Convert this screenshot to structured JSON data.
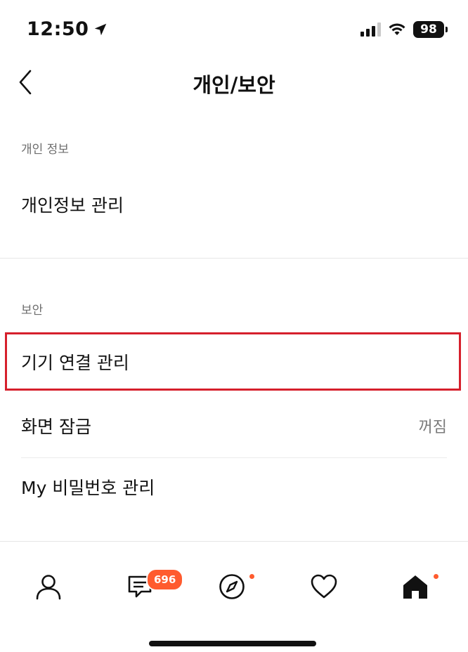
{
  "status_bar": {
    "time": "12:50",
    "battery": "98"
  },
  "header": {
    "title": "개인/보안"
  },
  "sections": {
    "personal": {
      "label": "개인 정보",
      "rows": [
        {
          "label": "개인정보 관리"
        }
      ]
    },
    "security": {
      "label": "보안",
      "rows": [
        {
          "label": "기기 연결 관리"
        },
        {
          "label": "화면 잠금",
          "value": "꺼짐"
        },
        {
          "label": "My 비밀번호 관리"
        }
      ]
    }
  },
  "bottom_nav": {
    "chat_badge": "696",
    "items": [
      "profile-icon",
      "chat-icon",
      "compass-icon",
      "heart-icon",
      "home-icon"
    ]
  },
  "colors": {
    "highlight": "#d6202c",
    "accent": "#ff5b2e"
  }
}
